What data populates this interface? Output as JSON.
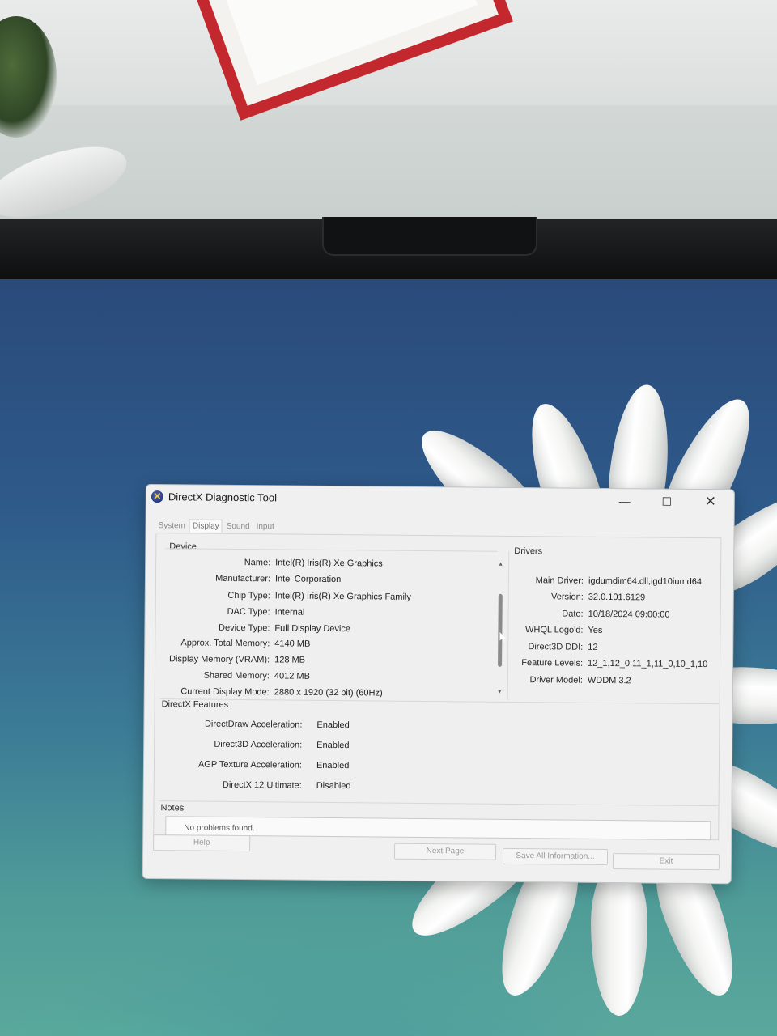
{
  "window": {
    "title": "DirectX Diagnostic Tool",
    "icon": "directx-x-icon",
    "controls": {
      "minimize": "—",
      "maximize": "☐",
      "close": "✕"
    }
  },
  "tabs": [
    {
      "label": "System",
      "active": false
    },
    {
      "label": "Display",
      "active": true
    },
    {
      "label": "Sound",
      "active": false
    },
    {
      "label": "Input",
      "active": false
    }
  ],
  "device": {
    "heading": "Device",
    "rows": [
      {
        "label": "Name:",
        "value": "Intel(R) Iris(R) Xe Graphics"
      },
      {
        "label": "Manufacturer:",
        "value": "Intel Corporation"
      },
      {
        "label": "Chip Type:",
        "value": "Intel(R) Iris(R) Xe Graphics Family"
      },
      {
        "label": "DAC Type:",
        "value": "Internal"
      },
      {
        "label": "Device Type:",
        "value": "Full Display Device"
      },
      {
        "label": "Approx. Total Memory:",
        "value": "4140 MB"
      },
      {
        "label": "Display Memory (VRAM):",
        "value": "128 MB"
      },
      {
        "label": "Shared Memory:",
        "value": "4012 MB"
      },
      {
        "label": "Current Display Mode:",
        "value": "2880 x 1920 (32 bit) (60Hz)"
      }
    ],
    "scroll_up": "▲",
    "scroll_down": "▼"
  },
  "drivers": {
    "heading": "Drivers",
    "rows": [
      {
        "label": "Main Driver:",
        "value": "igdumdim64.dll,igd10iumd64"
      },
      {
        "label": "Version:",
        "value": "32.0.101.6129"
      },
      {
        "label": "Date:",
        "value": "10/18/2024 09:00:00"
      },
      {
        "label": "WHQL Logo'd:",
        "value": "Yes"
      },
      {
        "label": "Direct3D DDI:",
        "value": "12"
      },
      {
        "label": "Feature Levels:",
        "value": "12_1,12_0,11_1,11_0,10_1,10"
      },
      {
        "label": "Driver Model:",
        "value": "WDDM 3.2"
      }
    ]
  },
  "features": {
    "heading": "DirectX Features",
    "rows": [
      {
        "label": "DirectDraw Acceleration:",
        "value": "Enabled"
      },
      {
        "label": "Direct3D Acceleration:",
        "value": "Enabled"
      },
      {
        "label": "AGP Texture Acceleration:",
        "value": "Enabled"
      },
      {
        "label": "DirectX 12 Ultimate:",
        "value": "Disabled"
      }
    ]
  },
  "notes": {
    "heading": "Notes",
    "text": "No problems found."
  },
  "buttons": {
    "help": "Help",
    "next_page": "Next Page",
    "save_all": "Save All Information...",
    "exit": "Exit"
  }
}
